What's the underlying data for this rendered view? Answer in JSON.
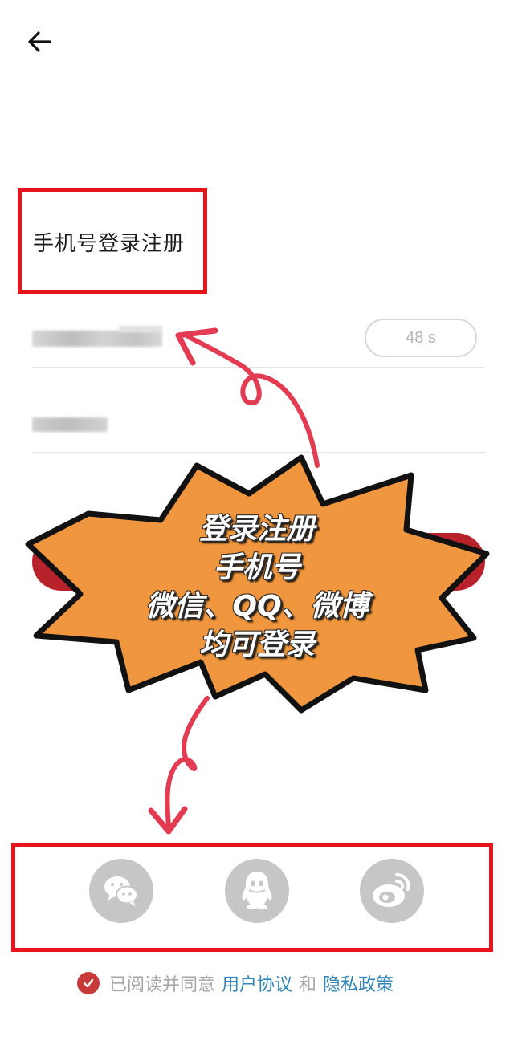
{
  "header": {
    "back_icon": "arrow-left-icon"
  },
  "title": "手机号登录注册",
  "inputs": {
    "phone_value": "",
    "code_value": ""
  },
  "countdown_label": "48 s",
  "callout": {
    "line1": "登录注册",
    "line2": "手机号",
    "line3": "微信、QQ、微博",
    "line4": "均可登录"
  },
  "social": [
    {
      "icon": "wechat-icon"
    },
    {
      "icon": "qq-icon"
    },
    {
      "icon": "weibo-icon"
    }
  ],
  "agreement": {
    "prefix": "已阅读并同意",
    "user_agreement": "用户协议",
    "and": "和",
    "privacy_policy": "隐私政策"
  },
  "colors": {
    "accent_red": "#b8232b",
    "annotation_red": "#e8141c",
    "burst_orange": "#f0963e",
    "link_blue": "#2f86b8",
    "icon_gray": "#c6c6c6"
  }
}
